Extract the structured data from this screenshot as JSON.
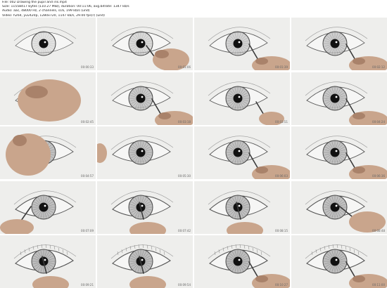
{
  "header": {
    "file": "File: 002 Drawing the pupil and iris.mp4",
    "size": "Size: 11558417 bytes (110.27 MiB), duration: 00:11:06, avg.bitrate: 1347 kb/s",
    "audio": "Audio: aac, 48000 Hz, 2 channels, s16, 199 kb/s (und)",
    "video": "Video: h264, yuv420p, 1280x720, 1147 kb/s, 29.00 fps(r) (und)",
    "url": "https://www.example.com/drawing"
  },
  "thumbnails": [
    {
      "time": "00:00:33",
      "hand": "none",
      "iris": 0.35,
      "outline": 0.5
    },
    {
      "time": "00:01:06",
      "hand": "right",
      "iris": 0.5,
      "outline": 0.6
    },
    {
      "time": "00:01:39",
      "hand": "right-low",
      "iris": 0.6,
      "outline": 0.6
    },
    {
      "time": "00:02:12",
      "hand": "right-low",
      "iris": 0.7,
      "outline": 0.6
    },
    {
      "time": "00:02:45",
      "hand": "big",
      "iris": 0.75,
      "outline": 0.6
    },
    {
      "time": "00:03:18",
      "hand": "right-low",
      "iris": 0.8,
      "outline": 0.6
    },
    {
      "time": "00:03:51",
      "hand": "pencil",
      "iris": 0.85,
      "outline": 0.6
    },
    {
      "time": "00:04:24",
      "hand": "right-low",
      "iris": 0.85,
      "outline": 0.7
    },
    {
      "time": "00:04:57",
      "hand": "left-big",
      "iris": 0.9,
      "outline": 0.7
    },
    {
      "time": "00:05:30",
      "hand": "left-edge",
      "iris": 0.9,
      "outline": 0.8
    },
    {
      "time": "00:06:03",
      "hand": "right-low",
      "iris": 0.9,
      "outline": 0.8
    },
    {
      "time": "00:06:36",
      "hand": "right-low",
      "iris": 0.9,
      "outline": 0.8
    },
    {
      "time": "00:07:09",
      "hand": "left-low",
      "iris": 0.95,
      "outline": 0.9
    },
    {
      "time": "00:07:42",
      "hand": "bottom-center",
      "iris": 0.95,
      "outline": 0.9
    },
    {
      "time": "00:08:15",
      "hand": "bottom-center",
      "iris": 0.95,
      "outline": 0.9
    },
    {
      "time": "00:08:48",
      "hand": "right-mid",
      "iris": 0.95,
      "outline": 0.9
    },
    {
      "time": "00:09:21",
      "hand": "bottom-center",
      "iris": 1,
      "outline": 1
    },
    {
      "time": "00:09:54",
      "hand": "bottom-center",
      "iris": 1,
      "outline": 1
    },
    {
      "time": "00:10:27",
      "hand": "right-low",
      "iris": 1,
      "outline": 1
    },
    {
      "time": "00:11:00",
      "hand": "right-low",
      "iris": 1,
      "outline": 1
    }
  ]
}
